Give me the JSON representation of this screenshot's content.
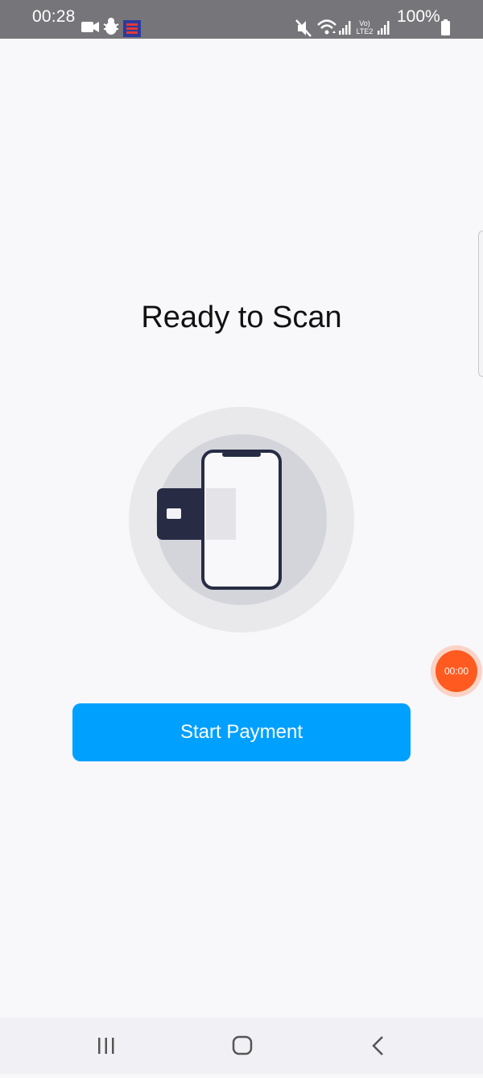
{
  "status_bar": {
    "time": "00:28",
    "battery": "100%",
    "network_label": "Vo) LTE2",
    "icons": [
      "video-camera-icon",
      "bug-icon",
      "app-notification-icon",
      "mute-icon",
      "wifi-icon",
      "signal-icon",
      "volte-icon",
      "signal-icon",
      "battery-icon"
    ]
  },
  "main": {
    "title": "Ready to Scan",
    "illustration": "phone-card-tap-icon",
    "start_button_label": "Start Payment"
  },
  "recorder": {
    "timer": "00:00"
  },
  "nav": {
    "items": [
      "recents-icon",
      "home-icon",
      "back-icon"
    ]
  },
  "colors": {
    "accent": "#00a0ff",
    "status_bar": "#76767a",
    "background": "#f8f7fa",
    "card": "#272c44",
    "recorder": "#ff5a1f"
  }
}
